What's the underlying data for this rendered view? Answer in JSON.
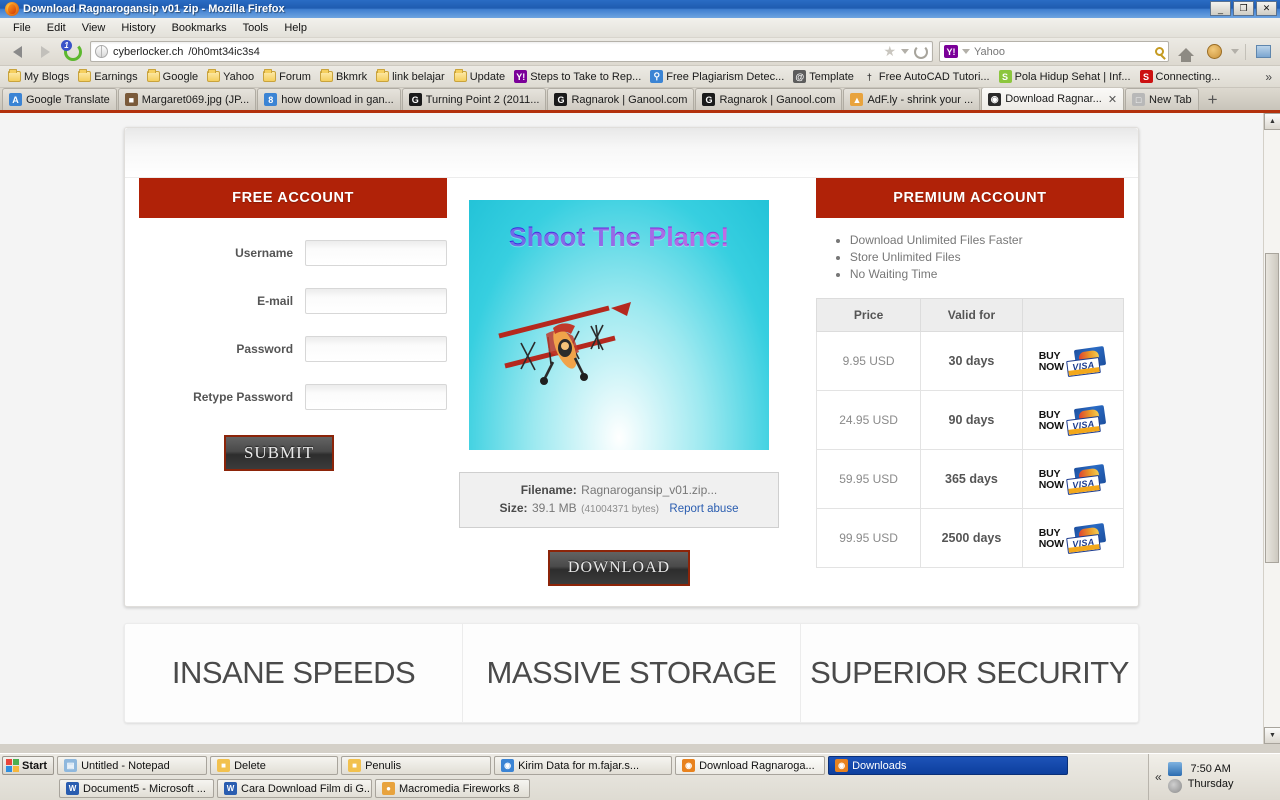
{
  "window": {
    "title": "Download Ragnarogansip v01 zip - Mozilla Firefox",
    "minimize": "_",
    "maximize": "❐",
    "close": "✕"
  },
  "menu": [
    "File",
    "Edit",
    "View",
    "History",
    "Bookmarks",
    "Tools",
    "Help"
  ],
  "nav": {
    "back_icon": "back-arrow-icon",
    "forward_icon": "forward-arrow-icon",
    "reload_icon": "reload-icon",
    "reload_badge": "1",
    "url_host": "cyberlocker.ch",
    "url_path": "/0h0mt34ic3s4",
    "star_icon": "★",
    "search_engine": "Y!",
    "search_placeholder": "Yahoo",
    "home_icon": "home-icon",
    "persona_icon": "monkey-avatar-icon",
    "picture_icon": "picture-icon"
  },
  "bookmarks": [
    {
      "label": "My Blogs",
      "icon": "folder"
    },
    {
      "label": "Earnings",
      "icon": "folder"
    },
    {
      "label": "Google",
      "icon": "folder"
    },
    {
      "label": "Yahoo",
      "icon": "folder"
    },
    {
      "label": "Forum",
      "icon": "folder"
    },
    {
      "label": "Bkmrk",
      "icon": "folder"
    },
    {
      "label": "link belajar",
      "icon": "folder"
    },
    {
      "label": "Update",
      "icon": "folder"
    },
    {
      "label": "Steps to Take to Rep...",
      "icon": "yahoo",
      "glyph": "Y!",
      "color": "#7b0099"
    },
    {
      "label": "Free Plagiarism Detec...",
      "icon": "magnifier",
      "glyph": "⚲",
      "color": "#3b84d4"
    },
    {
      "label": "Template",
      "icon": "spiral",
      "glyph": "@",
      "color": "#5c5c5c"
    },
    {
      "label": "Free AutoCAD Tutori...",
      "icon": "cad",
      "glyph": "†",
      "color": "#ffffff"
    },
    {
      "label": "Pola Hidup Sehat | Inf...",
      "icon": "letter-s",
      "glyph": "S",
      "color": "#8cc63e"
    },
    {
      "label": "Connecting...",
      "icon": "letter-s-red",
      "glyph": "S",
      "color": "#cc1111"
    }
  ],
  "bookmarks_overflow": "»",
  "tabs": [
    {
      "label": "Google Translate",
      "glyph": "A",
      "color": "#3b84d4",
      "active": false,
      "closable": false
    },
    {
      "label": "Margaret069.jpg (JP...",
      "glyph": "■",
      "color": "#7a5a3a",
      "active": false,
      "closable": false
    },
    {
      "label": "how download in gan...",
      "glyph": "8",
      "color": "#3b84d4",
      "active": false,
      "closable": false
    },
    {
      "label": "Turning Point 2 (2011...",
      "glyph": "G",
      "color": "#1a1a1a",
      "active": false,
      "closable": false
    },
    {
      "label": "Ragnarok | Ganool.com",
      "glyph": "G",
      "color": "#1a1a1a",
      "active": false,
      "closable": false
    },
    {
      "label": "Ragnarok | Ganool.com",
      "glyph": "G",
      "color": "#1a1a1a",
      "active": false,
      "closable": false
    },
    {
      "label": "AdF.ly - shrink your ...",
      "glyph": "▲",
      "color": "#e8a33d",
      "active": false,
      "closable": false
    },
    {
      "label": "Download Ragnar...",
      "glyph": "◉",
      "color": "#2b2b2b",
      "active": true,
      "closable": true,
      "close": "✕"
    },
    {
      "label": "New Tab",
      "glyph": "□",
      "color": "#b8b8b8",
      "active": false,
      "closable": false
    }
  ],
  "new_tab_plus": "+",
  "page": {
    "free_account": {
      "heading": "FREE ACCOUNT",
      "fields": [
        {
          "label": "Username",
          "value": "",
          "type": "text"
        },
        {
          "label": "E-mail",
          "value": "",
          "type": "text"
        },
        {
          "label": "Password",
          "value": "",
          "type": "password"
        },
        {
          "label": "Retype Password",
          "value": "",
          "type": "password"
        }
      ],
      "submit_label": "SUBMIT"
    },
    "advert": {
      "title": "Shoot The Plane!",
      "image": "biplane-illustration"
    },
    "file": {
      "filename_label": "Filename:",
      "filename_value": "Ragnarogansip_v01.zip...",
      "size_label": "Size:",
      "size_value": "39.1 MB",
      "size_bytes": "(41004371 bytes)",
      "report_abuse": "Report abuse",
      "download_label": "DOWNLOAD"
    },
    "premium_account": {
      "heading": "PREMIUM ACCOUNT",
      "benefits": [
        "Download Unlimited Files Faster",
        "Store Unlimited Files",
        "No Waiting Time"
      ],
      "table": {
        "headers": [
          "Price",
          "Valid for",
          ""
        ],
        "rows": [
          {
            "price": "9.95 USD",
            "valid": "30 days",
            "buy": "BUY NOW"
          },
          {
            "price": "24.95 USD",
            "valid": "90 days",
            "buy": "BUY NOW"
          },
          {
            "price": "59.95 USD",
            "valid": "365 days",
            "buy": "BUY NOW"
          },
          {
            "price": "99.95 USD",
            "valid": "2500 days",
            "buy": "BUY NOW"
          }
        ],
        "buy_line1": "BUY",
        "buy_line2": "NOW",
        "visa_text": "VISA"
      }
    },
    "features": [
      "INSANE SPEEDS",
      "MASSIVE STORAGE",
      "SUPERIOR SECURITY"
    ]
  },
  "taskbar": {
    "start_label": "Start",
    "row1": [
      {
        "label": "Untitled - Notepad",
        "glyph": "▤",
        "color": "#8fb8dd",
        "state": "normal"
      },
      {
        "label": "Delete",
        "glyph": "■",
        "color": "#f2c14e",
        "state": "normal"
      },
      {
        "label": "Penulis",
        "glyph": "■",
        "color": "#f2c14e",
        "state": "normal"
      },
      {
        "label": "Kirim Data for m.fajar.s...",
        "glyph": "◉",
        "color": "#3b84d4",
        "state": "normal"
      },
      {
        "label": "Download Ragnaroga...",
        "glyph": "◉",
        "color": "#e8821e",
        "state": "focus"
      },
      {
        "label": "Downloads",
        "glyph": "◉",
        "color": "#e8821e",
        "state": "active"
      }
    ],
    "row2": [
      {
        "label": "Document5 - Microsoft ...",
        "glyph": "W",
        "color": "#2a5db0",
        "state": "normal"
      },
      {
        "label": "Cara Download Film di G...",
        "glyph": "W",
        "color": "#2a5db0",
        "state": "normal"
      },
      {
        "label": "Macromedia Fireworks 8",
        "glyph": "●",
        "color": "#e8a33d",
        "state": "normal"
      }
    ],
    "tray": {
      "expand": "«",
      "network_icon": "network-icon",
      "volume_icon": "volume-icon",
      "time": "7:50 AM",
      "day": "Thursday"
    }
  },
  "colors": {
    "brand_red": "#b02208",
    "title_blue": "#1f5cb0",
    "tab_underline": "#b3310c",
    "taskbar_active": "#0d3f9e"
  }
}
